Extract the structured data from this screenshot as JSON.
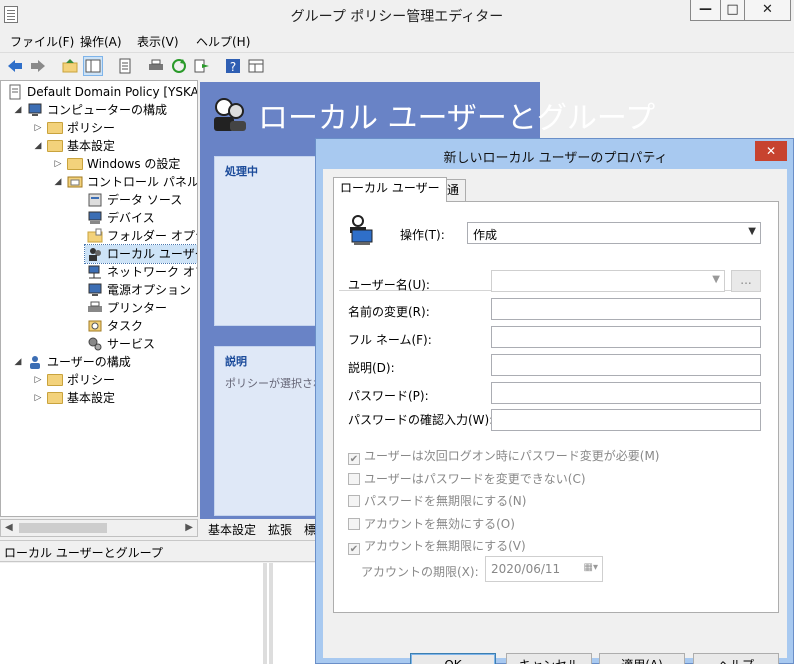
{
  "window": {
    "title": "グループ ポリシー管理エディター",
    "controls": {
      "minimize": "—",
      "maximize": "□",
      "close": "✕"
    }
  },
  "menu": [
    "ファイル(F)",
    "操作(A)",
    "表示(V)",
    "ヘルプ(H)"
  ],
  "toolbar_icons": [
    "back-arrow-icon",
    "forward-arrow-icon",
    "up-folder-icon",
    "show-hide-tree-icon",
    "properties-icon",
    "print-icon",
    "refresh-icon",
    "export-icon",
    "help-icon",
    "filter-icon"
  ],
  "tree": {
    "root": "Default Domain Policy [YSKA",
    "computer_config": "コンピューターの構成",
    "policy": "ポリシー",
    "preferences": "基本設定",
    "windows_settings": "Windows の設定",
    "control_panel": "コントロール パネルの設",
    "datasource": "データ ソース",
    "devices": "デバイス",
    "folder_options": "フォルダー オプション",
    "local_users": "ローカル ユーザーとク",
    "network_options": "ネットワーク オプショ",
    "power_options": "電源オプション",
    "printers": "プリンター",
    "tasks": "タスク",
    "services": "サービス",
    "user_config": "ユーザーの構成",
    "user_policy": "ポリシー",
    "user_preferences": "基本設定"
  },
  "right_pane": {
    "heading": "ローカル ユーザーとグループ",
    "processing_header": "処理中",
    "description_header": "説明",
    "description_text": "ポリシーが選択され"
  },
  "bottom_tabs": [
    "基本設定",
    "拡張",
    "標"
  ],
  "status_text": "ローカル ユーザーとグループ",
  "dialog": {
    "title": "新しいローカル ユーザーのプロパティ",
    "close": "✕",
    "tabs": [
      "ローカル ユーザー",
      "共通"
    ],
    "action_label": "操作(T):",
    "action_value": "作成",
    "fields": {
      "username": "ユーザー名(U):",
      "rename": "名前の変更(R):",
      "fullname": "フル ネーム(F):",
      "description": "説明(D):",
      "password": "パスワード(P):",
      "confirm_password": "パスワードの確認入力(W):"
    },
    "browse": "...",
    "checkboxes": [
      {
        "label": "ユーザーは次回ログオン時にパスワード変更が必要(M)",
        "checked": true
      },
      {
        "label": "ユーザーはパスワードを変更できない(C)",
        "checked": false
      },
      {
        "label": "パスワードを無期限にする(N)",
        "checked": false
      },
      {
        "label": "アカウントを無効にする(O)",
        "checked": false
      },
      {
        "label": "アカウントを無期限にする(V)",
        "checked": true
      }
    ],
    "expiry_label": "アカウントの期限(X):",
    "expiry_value": "2020/06/11",
    "buttons": {
      "ok": "OK",
      "cancel": "キャンセル",
      "apply": "適用(A)",
      "help": "ヘルプ"
    }
  }
}
